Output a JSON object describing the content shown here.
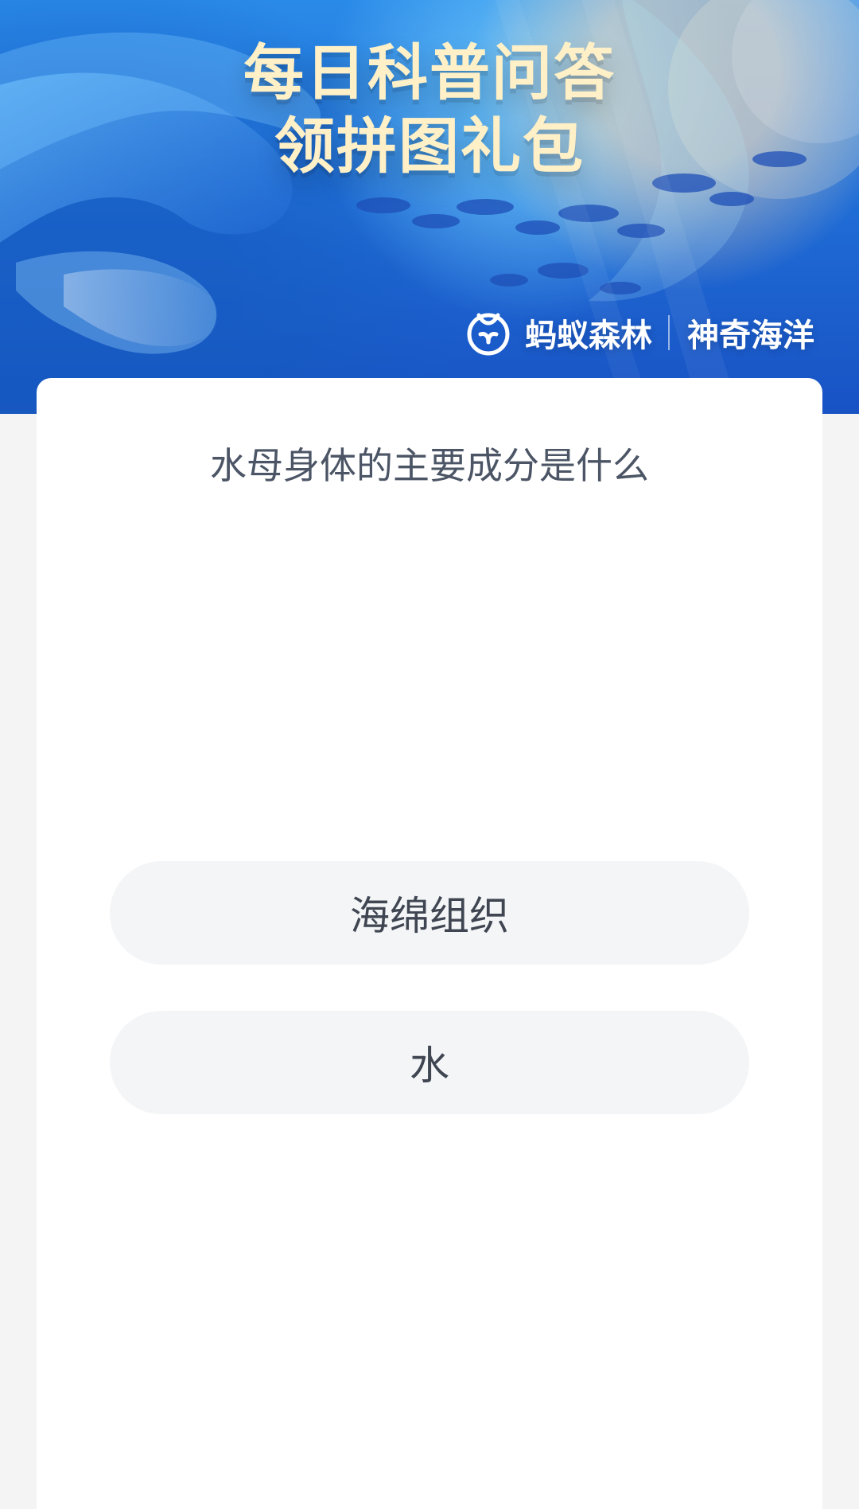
{
  "banner": {
    "title_line1": "每日科普问答",
    "title_line2": "领拼图礼包",
    "brand_left": "蚂蚁森林",
    "brand_right": "神奇海洋",
    "icons": {
      "brand_logo": "ant-forest-logo-icon"
    }
  },
  "quiz": {
    "question": "水母身体的主要成分是什么",
    "options": [
      {
        "label": "海绵组织"
      },
      {
        "label": "水"
      }
    ]
  },
  "colors": {
    "banner_blue": "#1e67d2",
    "banner_title": "#fff0c7",
    "page_bg": "#f4f4f5",
    "card_bg": "#ffffff",
    "option_bg": "#f4f5f7",
    "text_primary": "#3f4652",
    "text_question": "#4b5565"
  }
}
